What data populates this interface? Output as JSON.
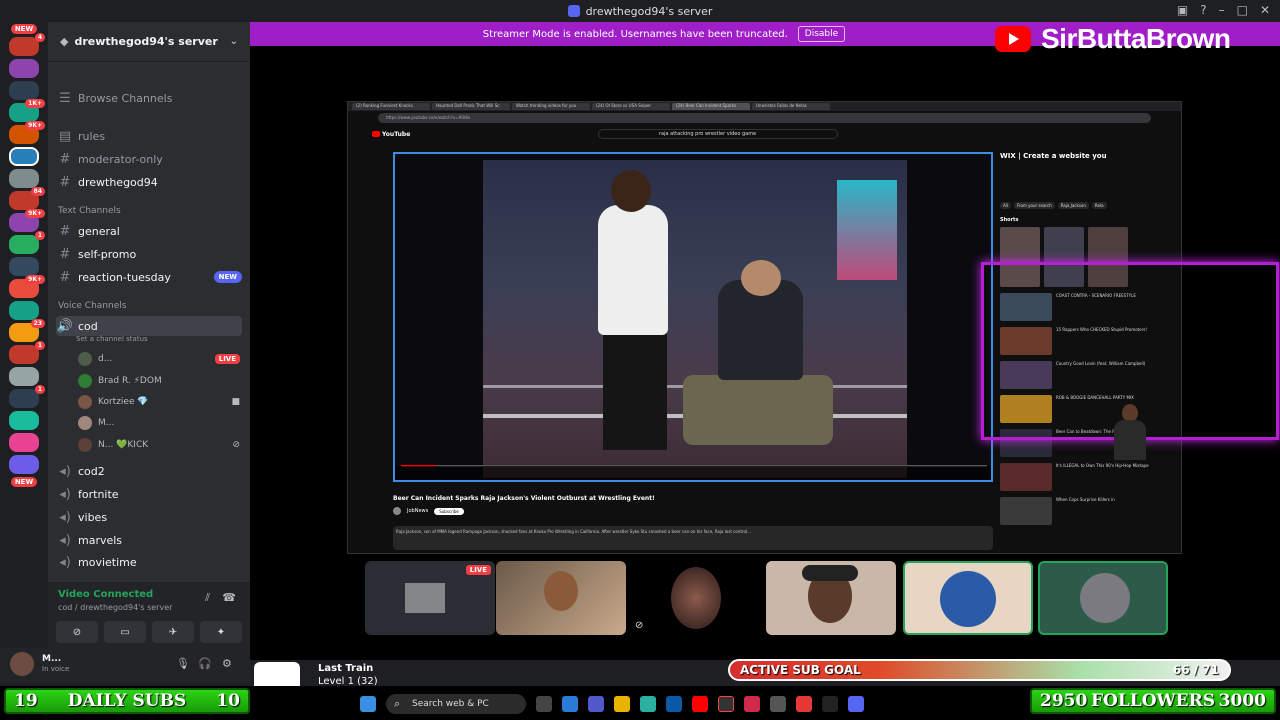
{
  "window": {
    "title": "drewthegod94's server"
  },
  "streamer_mode": {
    "message": "Streamer Mode is enabled. Usernames have been truncated.",
    "disable_label": "Disable"
  },
  "brand": {
    "name": "SirButtaBrown",
    "accent": "#ff0000"
  },
  "rail": {
    "new_top": "NEW",
    "new_bottom": "NEW",
    "badges": [
      "4",
      "",
      "1K+",
      "9K+",
      "",
      "",
      "84",
      "9K+",
      "1",
      "",
      "9K+",
      "23",
      "1",
      "",
      "1",
      "",
      "",
      "",
      ""
    ]
  },
  "sidebar": {
    "server_name": "drewthegod94's server",
    "browse_channels": "Browse Channels",
    "top_channels": [
      "rules",
      "moderator-only",
      "drewthegod94"
    ],
    "text_category": "Text Channels",
    "text_channels": [
      "general",
      "self-promo",
      "reaction-tuesday"
    ],
    "new_tag": "NEW",
    "voice_category": "Voice Channels",
    "voice_channel": "cod",
    "channel_status": "Set a channel status",
    "voice_users": [
      {
        "name": "d...",
        "tag": "LIVE"
      },
      {
        "name": "Brad R. ⚡DOM",
        "tag": ""
      },
      {
        "name": "Kortziee 💎",
        "tag": ""
      },
      {
        "name": "M...",
        "tag": ""
      },
      {
        "name": "N... 💚KICK",
        "tag": ""
      }
    ],
    "other_channels": [
      "cod2",
      "fortnite",
      "vibes",
      "marvels",
      "movietime"
    ]
  },
  "voice_panel": {
    "title": "Video Connected",
    "subtitle": "cod / drewthegod94's server"
  },
  "user_panel": {
    "name": "M...",
    "status": "In voice"
  },
  "browser": {
    "url": "https://www.youtube.com/watch?v=9OI8x",
    "search": "raja attacking pro wrestler video game",
    "youtube_label": "YouTube",
    "video_title": "Beer Can Incident Sparks Raja Jackson's Violent Outburst at Wrestling Event!",
    "channel": "JobNews",
    "subscribe": "Subscribe",
    "progress": 0.06,
    "ad_text": "WIX | Create a website you",
    "shorts_label": "Shorts",
    "chips": [
      "All",
      "From your search",
      "Raja Jackson",
      "Rela"
    ],
    "recommendations": [
      "COAST CONTRA - SCENARIO FREESTYLE",
      "15 Rappers Who CHECKED Stupid Promoters!",
      "Country Good Lovin (feat. William Campbell)",
      "ROB & BOOGIE DANCEHALL PARTY MIX",
      "Beer Can to Beatdown: The Full Timeline",
      "It's ILLEGAL to Own This 90's Hip-Hop Mixtape",
      "When Cops Surprise Killers in"
    ],
    "tabs": [
      "(2) Ranking Funniest Knocks",
      "Haunted Doll Prank That Will Sc",
      "Watch trending videos for you",
      "(24) OI Store vs USA Sniper",
      "(24) Beer Can Incident Sparks",
      "Unwristos Fallas de Nelas"
    ]
  },
  "tiles": [
    {
      "label": "LIVE"
    },
    {
      "label": ""
    },
    {
      "label": ""
    },
    {
      "label": ""
    },
    {
      "label": ""
    },
    {
      "label": ""
    }
  ],
  "overlay": {
    "daily_subs": {
      "left": "19",
      "label": "DAILY SUBS",
      "right": "10"
    },
    "followers": {
      "left": "2950",
      "label": "FOLLOWERS",
      "right": "3000"
    },
    "sub_goal": {
      "label": "ACTIVE SUB GOAL",
      "current": 66,
      "target": 71,
      "text": "66 / 71"
    },
    "train": {
      "title": "Last Train",
      "level": "Level 1 (32)"
    }
  },
  "taskbar": {
    "search_placeholder": "Search web & PC"
  }
}
